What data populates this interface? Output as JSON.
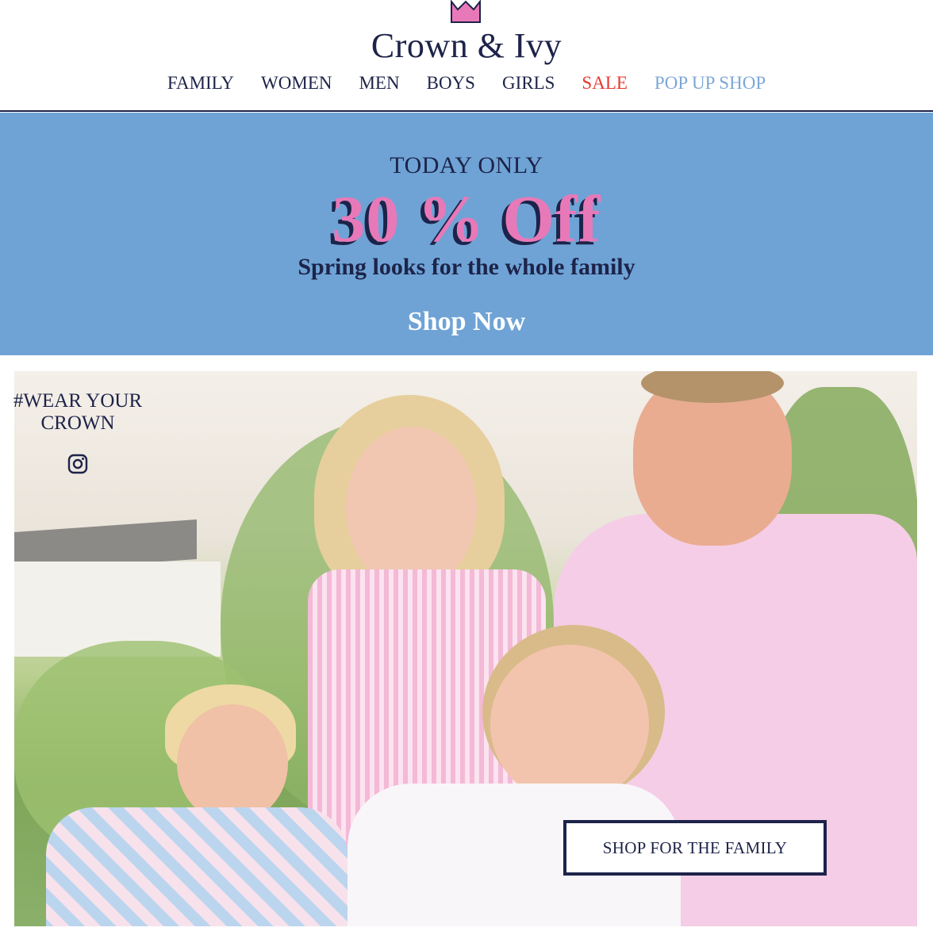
{
  "header": {
    "brand": "Crown & Ivy",
    "logo_icon": "crown-icon",
    "nav": [
      {
        "label": "FAMILY"
      },
      {
        "label": "WOMEN"
      },
      {
        "label": "MEN"
      },
      {
        "label": "BOYS"
      },
      {
        "label": "GIRLS"
      },
      {
        "label": "SALE",
        "color": "#e8392f"
      },
      {
        "label": "POP UP SHOP",
        "color": "#7ba7d8"
      }
    ]
  },
  "promo": {
    "eyebrow": "TODAY ONLY",
    "headline": "30 % Off",
    "subline": "Spring looks for the whole family",
    "cta": "Shop Now",
    "background": "#6fa3d6",
    "accent": "#e879b8"
  },
  "hero": {
    "hashtag_line1": "#WEAR YOUR",
    "hashtag_line2": "CROWN",
    "social_icon": "instagram-icon",
    "cta": "SHOP FOR THE FAMILY"
  },
  "colors": {
    "navy": "#1d2349",
    "sale_red": "#e8392f",
    "popup_blue": "#7ba7d8"
  }
}
